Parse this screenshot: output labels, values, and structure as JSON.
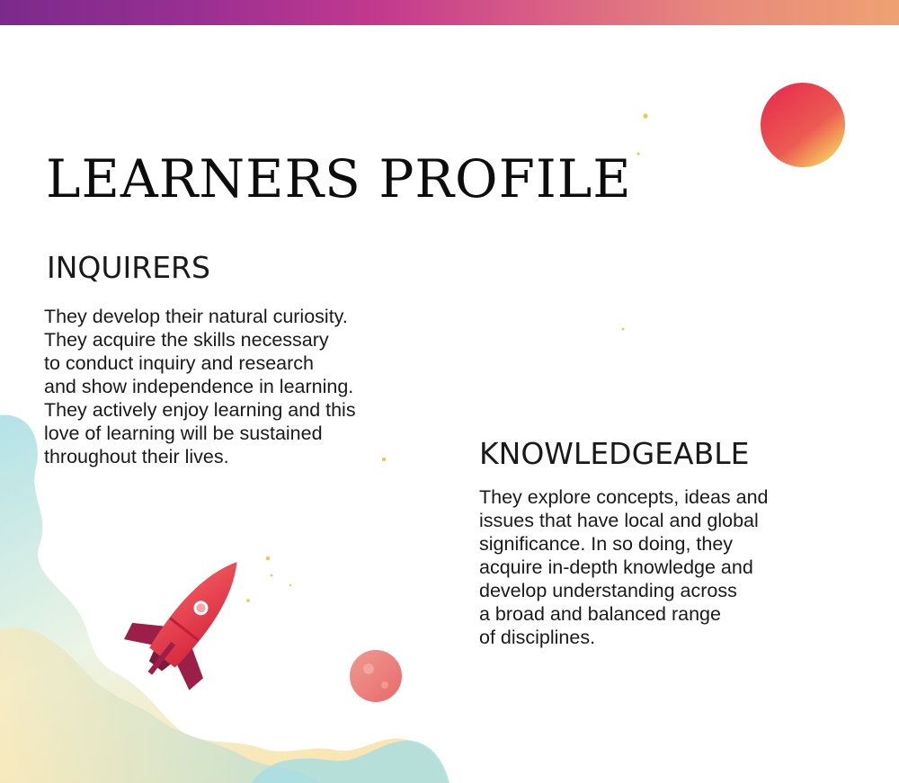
{
  "title": "LEARNERS PROFILE",
  "sections": [
    {
      "heading": "INQUIRERS",
      "lines": [
        "They develop their natural curiosity.",
        "They acquire the skills necessary",
        "to conduct inquiry and research",
        "and show independence in learning.",
        "They actively enjoy learning and this",
        "love of learning will be sustained",
        "throughout their lives."
      ]
    },
    {
      "heading": "KNOWLEDGEABLE",
      "lines": [
        "They explore concepts, ideas and",
        "issues that have local and global",
        "significance. In so doing, they",
        "acquire in-depth knowledge and",
        "develop understanding across",
        "a broad and balanced range",
        "of disciplines."
      ]
    }
  ],
  "colors": {
    "banner_gradient": [
      "#7b2a8c",
      "#c2398e",
      "#efa172"
    ],
    "planet_large": [
      "#e8364f",
      "#f7d25e"
    ],
    "planet_small": [
      "#e86a6a",
      "#f4a7a0"
    ],
    "rocket_body": "#e8364f",
    "rocket_fins": "#9c1f4a",
    "smoke": [
      "#a6dde3",
      "#f9e2a6"
    ]
  },
  "icons": {
    "rocket": "rocket-icon",
    "planet_large": "planet-icon",
    "planet_small": "planet-icon",
    "stars": "star-icon"
  }
}
